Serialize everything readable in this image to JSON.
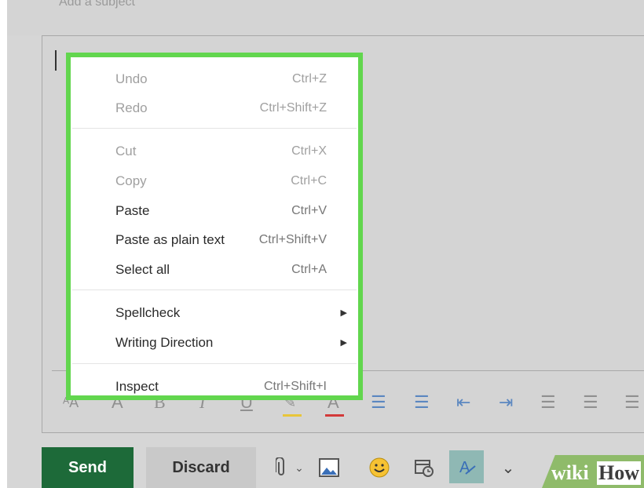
{
  "subject": {
    "placeholder": "Add a subject"
  },
  "context_menu": {
    "groups": [
      [
        {
          "label": "Undo",
          "shortcut": "Ctrl+Z",
          "enabled": false
        },
        {
          "label": "Redo",
          "shortcut": "Ctrl+Shift+Z",
          "enabled": false
        }
      ],
      [
        {
          "label": "Cut",
          "shortcut": "Ctrl+X",
          "enabled": false
        },
        {
          "label": "Copy",
          "shortcut": "Ctrl+C",
          "enabled": false
        },
        {
          "label": "Paste",
          "shortcut": "Ctrl+V",
          "enabled": true
        },
        {
          "label": "Paste as plain text",
          "shortcut": "Ctrl+Shift+V",
          "enabled": true
        },
        {
          "label": "Select all",
          "shortcut": "Ctrl+A",
          "enabled": true
        }
      ],
      [
        {
          "label": "Spellcheck",
          "submenu": true
        },
        {
          "label": "Writing Direction",
          "submenu": true
        }
      ],
      [
        {
          "label": "Inspect",
          "shortcut": "Ctrl+Shift+I",
          "enabled": true
        }
      ]
    ]
  },
  "actions": {
    "send": "Send",
    "discard": "Discard"
  },
  "watermark": {
    "wiki": "wiki",
    "how": "How"
  },
  "colors": {
    "send_bg": "#1d6a39",
    "highlight": "#62d64e",
    "accent_blue": "#5b87c0"
  }
}
